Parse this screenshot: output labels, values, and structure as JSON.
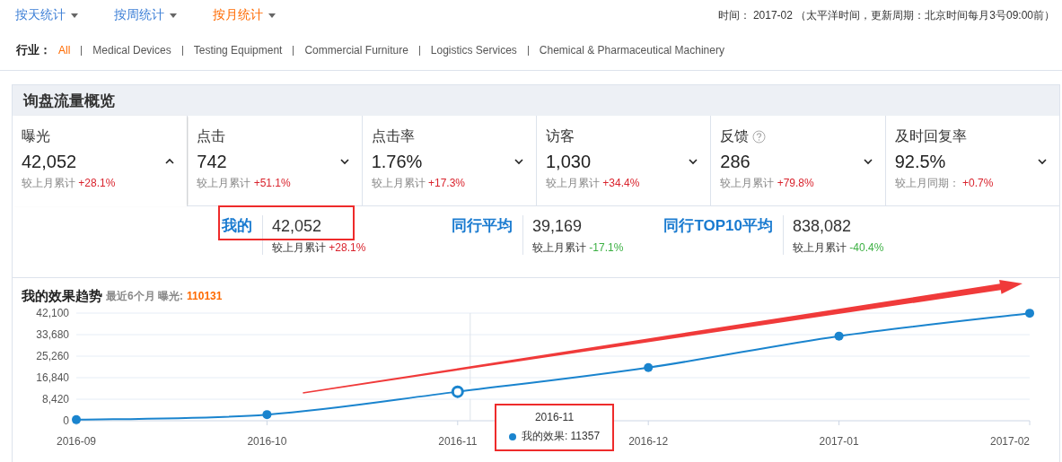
{
  "period_tabs": [
    {
      "label": "按天统计",
      "selected": false
    },
    {
      "label": "按周统计",
      "selected": false
    },
    {
      "label": "按月统计",
      "selected": true
    }
  ],
  "update_info": "时间： 2017-02 （太平洋时间，更新周期：北京时间每月3号09:00前）",
  "industry_filter": {
    "label": "行业：",
    "options": [
      {
        "label": "All",
        "selected": true
      },
      {
        "label": "Medical Devices",
        "selected": false
      },
      {
        "label": "Testing Equipment",
        "selected": false
      },
      {
        "label": "Commercial Furniture",
        "selected": false
      },
      {
        "label": "Logistics Services",
        "selected": false
      },
      {
        "label": "Chemical & Pharmaceutical Machinery",
        "selected": false
      }
    ]
  },
  "overview": {
    "title": "询盘流量概览",
    "metrics": [
      {
        "label": "曝光",
        "value": "42,052",
        "compare_label": "较上月累计",
        "change": "+28.1%",
        "color": "#d9232d",
        "expanded": true,
        "has_help": false
      },
      {
        "label": "点击",
        "value": "742",
        "compare_label": "较上月累计",
        "change": "+51.1%",
        "color": "#d9232d",
        "expanded": false,
        "has_help": false
      },
      {
        "label": "点击率",
        "value": "1.76%",
        "compare_label": "较上月累计",
        "change": "+17.3%",
        "color": "#d9232d",
        "expanded": false,
        "has_help": false
      },
      {
        "label": "访客",
        "value": "1,030",
        "compare_label": "较上月累计",
        "change": "+34.4%",
        "color": "#d9232d",
        "expanded": false,
        "has_help": false
      },
      {
        "label": "反馈",
        "value": "286",
        "compare_label": "较上月累计",
        "change": "+79.8%",
        "color": "#d9232d",
        "expanded": false,
        "has_help": true
      },
      {
        "label": "及时回复率",
        "value": "92.5%",
        "compare_label": "较上月同期：",
        "change": "+0.7%",
        "color": "#d9232d",
        "expanded": false,
        "has_help": false
      }
    ],
    "comparison": [
      {
        "label": "我的",
        "value": "42,052",
        "compare_label": "较上月累计",
        "change": "+28.1%",
        "color": "#d9232d",
        "highlighted": true
      },
      {
        "label": "同行平均",
        "value": "39,169",
        "compare_label": "较上月累计",
        "change": "-17.1%",
        "color": "#3cb043",
        "highlighted": false
      },
      {
        "label": "同行TOP10平均",
        "value": "838,082",
        "compare_label": "较上月累计",
        "change": "-40.4%",
        "color": "#3cb043",
        "highlighted": false
      }
    ],
    "trend": {
      "title": "我的效果趋势",
      "subtitle": "最近6个月 曝光:",
      "total": "110131",
      "chart_data": {
        "type": "line",
        "categories": [
          "2016-09",
          "2016-10",
          "2016-11",
          "2016-12",
          "2017-01",
          "2017-02"
        ],
        "series": [
          {
            "color": "#1a84ce",
            "marker": "circle",
            "values": [
              400,
              2400,
              11357,
              20800,
              33100,
              42052
            ]
          }
        ],
        "grid": true,
        "ylim": [
          0,
          42100
        ],
        "yticks": [
          {
            "value": 0,
            "label": "0"
          },
          {
            "value": 8420,
            "label": "8,420"
          },
          {
            "value": 16840,
            "label": "16,840"
          },
          {
            "value": 25260,
            "label": "25,260"
          },
          {
            "value": 33680,
            "label": "33,680"
          },
          {
            "value": 42100,
            "label": "42,100"
          }
        ]
      },
      "tooltip": {
        "title": "2016-11",
        "label": "我的效果: 11357",
        "highlighted": true
      }
    }
  }
}
